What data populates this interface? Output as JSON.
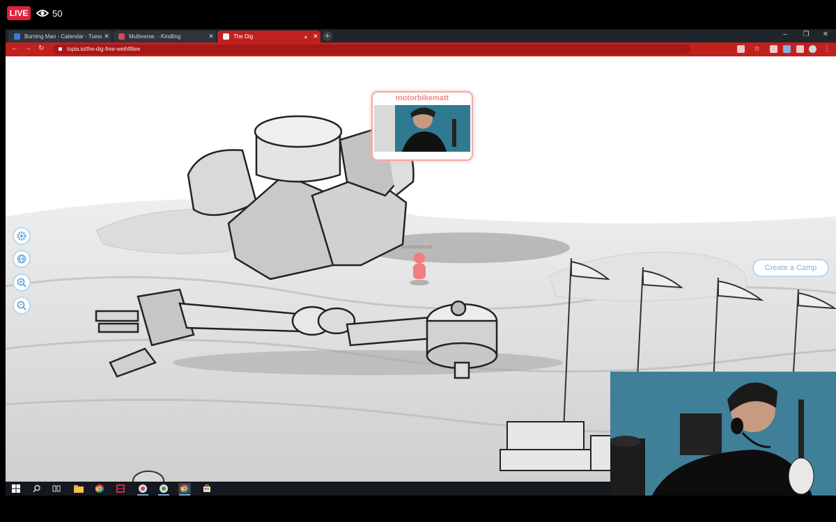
{
  "stream": {
    "live_label": "LIVE",
    "viewer_count": "50"
  },
  "browser": {
    "tabs": [
      {
        "label": "Burning Man - Calendar - Tuesd",
        "favicon_color": "#3b7bd6",
        "active": false
      },
      {
        "label": "Multiverse. - Kindling",
        "favicon_color": "#d8455a",
        "active": false
      },
      {
        "label": "The Dig",
        "favicon_color": "#f2f2f2",
        "active": true
      }
    ],
    "new_tab_label": "+",
    "url": "topia.io/the-dig-free-weihf8iee",
    "accent_color": "#c0211f"
  },
  "app": {
    "video_card_username": "motorbikematt",
    "avatar_name": "motorbikematt",
    "create_camp_label": "Create a Camp",
    "side_buttons": [
      "gear-icon",
      "globe-icon",
      "zoom-in-icon",
      "zoom-out-icon"
    ]
  },
  "taskbar": {
    "icons": [
      "windows-start-icon",
      "search-icon",
      "task-view-icon",
      "file-explorer-icon",
      "chrome-icon",
      "snip-icon",
      "app-icon",
      "app-icon",
      "chrome-icon",
      "store-icon"
    ]
  }
}
